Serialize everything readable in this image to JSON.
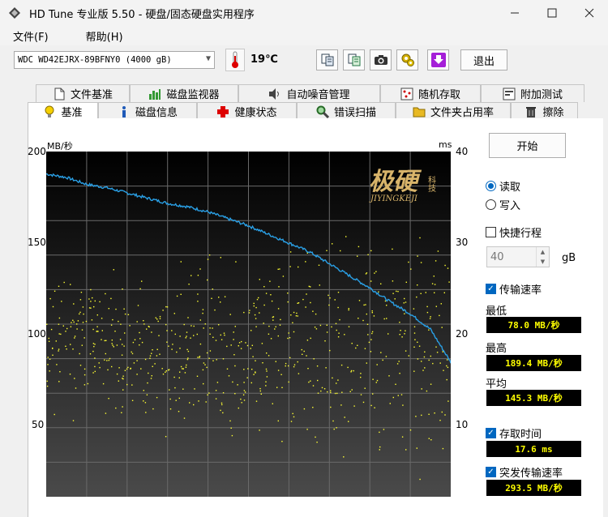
{
  "window": {
    "title": "HD Tune 专业版 5.50 - 硬盘/固态硬盘实用程序"
  },
  "menu": {
    "items": [
      "文件(F)",
      "帮助(H)"
    ]
  },
  "toolbar": {
    "drive": "WDC WD42EJRX-89BFNY0 (4000 gB)",
    "temperature": "19℃",
    "exit_label": "退出"
  },
  "tabs": {
    "row1": [
      "文件基准",
      "磁盘监视器",
      "自动噪音管理",
      "随机存取",
      "附加测试"
    ],
    "row2": [
      "基准",
      "磁盘信息",
      "健康状态",
      "错误扫描",
      "文件夹占用率",
      "擦除"
    ],
    "active": "基准"
  },
  "chart": {
    "left_unit": "MB/秒",
    "right_unit": "ms",
    "left_ticks": [
      "200",
      "150",
      "100",
      "50"
    ],
    "right_ticks": [
      "40",
      "30",
      "20",
      "10"
    ],
    "watermark_main": "极硬",
    "watermark_side": "科技",
    "watermark_sub": "JIYINGKEJI"
  },
  "chart_data": {
    "type": "line",
    "x": [
      0,
      5,
      10,
      15,
      20,
      25,
      30,
      35,
      40,
      45,
      50,
      55,
      60,
      65,
      70,
      75,
      80,
      85,
      90,
      95,
      100
    ],
    "series": [
      {
        "values": [
          187,
          185,
          181,
          179,
          176,
          173,
          170,
          168,
          165,
          161,
          157,
          152,
          147,
          142,
          135,
          128,
          121,
          113,
          106,
          97,
          78
        ]
      },
      {
        "values": [
          17.6
        ]
      }
    ],
    "ylim": [
      0,
      200
    ],
    "y2lim": [
      0,
      40
    ],
    "grid": true
  },
  "side": {
    "start_label": "开始",
    "read_label": "读取",
    "write_label": "写入",
    "short_stroke_label": "快捷行程",
    "short_stroke_value": "40",
    "gb_label": "gB",
    "transfer_rate_label": "传输速率",
    "min_label": "最低",
    "min_value": "78.0 MB/秒",
    "max_label": "最高",
    "max_value": "189.4 MB/秒",
    "avg_label": "平均",
    "avg_value": "145.3 MB/秒",
    "access_time_label": "存取时间",
    "access_time_value": "17.6 ms",
    "burst_label": "突发传输速率",
    "burst_value": "293.5 MB/秒"
  }
}
